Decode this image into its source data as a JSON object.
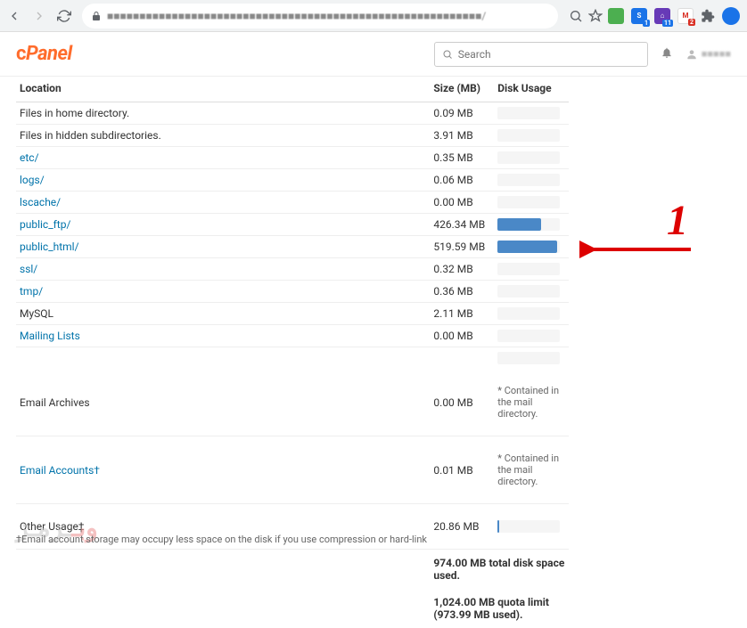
{
  "browser": {
    "url": "■■■■■■■■■■■■■■■■■■■■■■■■■■■■■■■■■■■■■■■■■■■■■■■■■■■■■■■■■■/",
    "ext_badges": [
      "1",
      "11",
      "2"
    ]
  },
  "header": {
    "logo": "cPanel",
    "search_placeholder": "Search"
  },
  "table": {
    "headers": {
      "location": "Location",
      "size": "Size (MB)",
      "usage": "Disk Usage"
    },
    "rows": [
      {
        "label": "Files in home directory.",
        "link": false,
        "size": "0.09 MB",
        "bar": 0
      },
      {
        "label": "Files in hidden subdirectories.",
        "link": false,
        "size": "3.91 MB",
        "bar": 0
      },
      {
        "label": "etc/",
        "link": true,
        "size": "0.35 MB",
        "bar": 0
      },
      {
        "label": "logs/",
        "link": true,
        "size": "0.06 MB",
        "bar": 0
      },
      {
        "label": "lscache/",
        "link": true,
        "size": "0.00 MB",
        "bar": 0
      },
      {
        "label": "public_ftp/",
        "link": true,
        "size": "426.34 MB",
        "bar": 70
      },
      {
        "label": "public_html/",
        "link": true,
        "size": "519.59 MB",
        "bar": 95
      },
      {
        "label": "ssl/",
        "link": true,
        "size": "0.32 MB",
        "bar": 0
      },
      {
        "label": "tmp/",
        "link": true,
        "size": "0.36 MB",
        "bar": 0
      },
      {
        "label": "MySQL",
        "link": false,
        "size": "2.11 MB",
        "bar": 0
      },
      {
        "label": "Mailing Lists",
        "link": true,
        "size": "0.00 MB",
        "bar": 0
      }
    ],
    "archives": {
      "label": "Email Archives",
      "size": "0.00 MB",
      "note": "* Contained in the mail directory."
    },
    "accounts": {
      "label": "Email Accounts†",
      "size": "0.01 MB",
      "note": "* Contained in the mail directory."
    },
    "other": {
      "label": "Other Usage‡",
      "size": "20.86 MB",
      "bar": 3
    },
    "totals": {
      "used": "974.00 MB total disk space used.",
      "quota": "1,024.00 MB quota limit (973.99 MB used)."
    }
  },
  "footnote": "†Email account storage may occupy less space on the disk if you use compression or hard-link",
  "annotation": {
    "number": "1"
  },
  "watermark": "وبــرمـز"
}
